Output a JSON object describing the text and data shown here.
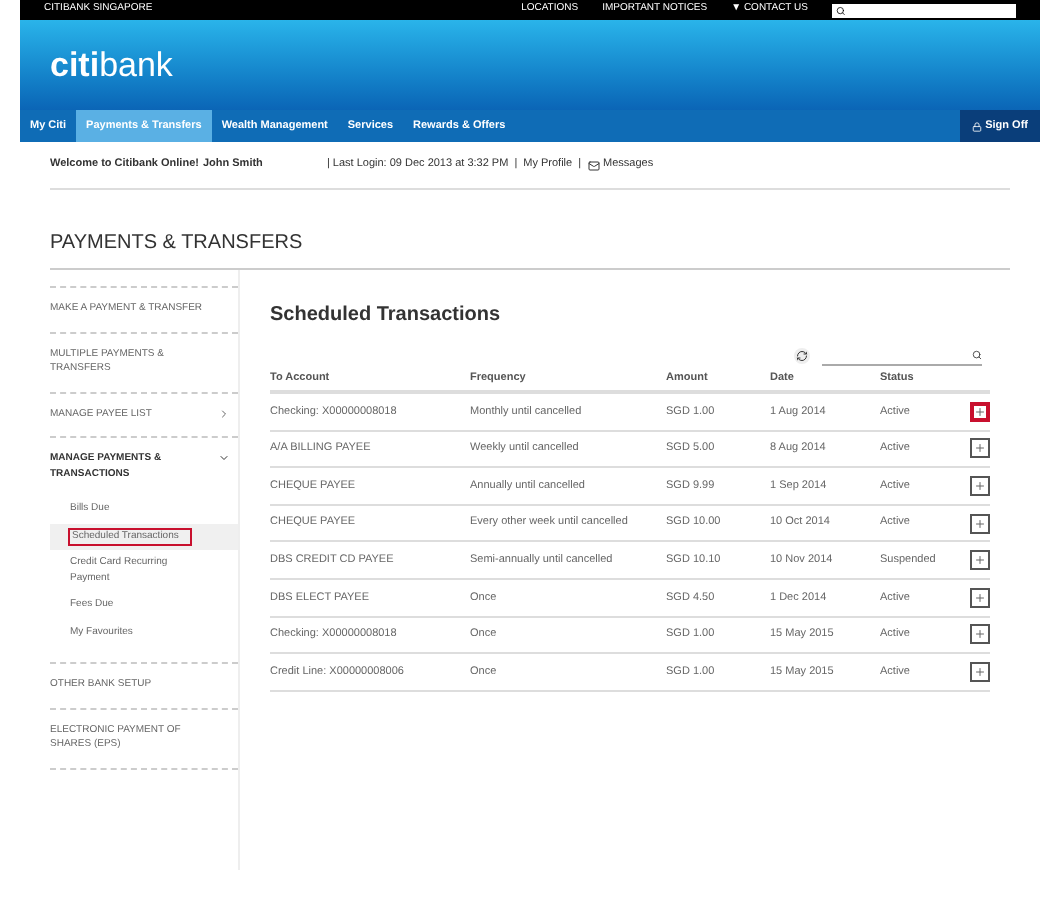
{
  "top_bar": {
    "site": "CITIBANK SINGAPORE",
    "links": [
      "LOCATIONS",
      "IMPORTANT NOTICES",
      "▼ CONTACT US"
    ]
  },
  "logo": {
    "text_a": "citi",
    "text_b": "bank"
  },
  "nav": {
    "tabs": [
      {
        "label": "My Citi",
        "selected": false
      },
      {
        "label": "Payments & Transfers",
        "selected": true
      },
      {
        "label": "Wealth Management",
        "selected": false
      },
      {
        "label": "Services",
        "selected": false
      },
      {
        "label": "Rewards & Offers",
        "selected": false
      }
    ],
    "sign_off": "Sign Off"
  },
  "welcome": {
    "greeting": "Welcome to Citibank Online!",
    "name": "John Smith",
    "last_login": "| Last Login: 09 Dec 2013 at 3:32 PM",
    "separators": [
      "|",
      "|"
    ],
    "profile": "My Profile",
    "messages": "Messages"
  },
  "page_title": "PAYMENTS & TRANSFERS",
  "sidebar": {
    "items": [
      {
        "label": "MAKE A PAYMENT & TRANSFER"
      },
      {
        "label": "MULTIPLE PAYMENTS & TRANSFERS"
      },
      {
        "label": "MANAGE PAYEE LIST",
        "expanded": false
      },
      {
        "label": "MANAGE PAYMENTS & TRANSACTIONS",
        "expanded": true,
        "children": [
          {
            "label": "Bills Due",
            "selected": false
          },
          {
            "label": "Scheduled Transactions",
            "selected": true
          },
          {
            "label": "Credit Card Recurring Payment",
            "selected": false
          },
          {
            "label": "Fees Due",
            "selected": false
          },
          {
            "label": "My Favourites",
            "selected": false
          }
        ]
      },
      {
        "label": "OTHER BANK SETUP"
      },
      {
        "label": "ELECTRONIC PAYMENT OF SHARES (EPS)"
      }
    ]
  },
  "main": {
    "title": "Scheduled Transactions",
    "table": {
      "columns": [
        "To Account",
        "Frequency",
        "Amount",
        "Date",
        "Status"
      ],
      "rows": [
        {
          "cells": [
            "Checking: X00000008018",
            "Monthly until cancelled",
            "SGD 1.00",
            "1 Aug 2014",
            "Active"
          ],
          "highlighted": true
        },
        {
          "cells": [
            "A/A BILLING PAYEE",
            "Weekly until cancelled",
            "SGD 5.00",
            "8 Aug 2014",
            "Active"
          ],
          "highlighted": false
        },
        {
          "cells": [
            "CHEQUE PAYEE",
            "Annually until cancelled",
            "SGD 9.99",
            "1 Sep 2014",
            "Active"
          ],
          "highlighted": false
        },
        {
          "cells": [
            "CHEQUE PAYEE",
            "Every other week until cancelled",
            "SGD 10.00",
            "10 Oct 2014",
            "Active"
          ],
          "highlighted": false
        },
        {
          "cells": [
            "DBS CREDIT CD PAYEE",
            "Semi-annually until cancelled",
            "SGD 10.10",
            "10 Nov 2014",
            "Suspended"
          ],
          "highlighted": false
        },
        {
          "cells": [
            "DBS ELECT PAYEE",
            "Once",
            "SGD 4.50",
            "1 Dec 2014",
            "Active"
          ],
          "highlighted": false
        },
        {
          "cells": [
            "Checking: X00000008018",
            "Once",
            "SGD 1.00",
            "15 May 2015",
            "Active"
          ],
          "highlighted": false
        },
        {
          "cells": [
            "Credit Line: X00000008006",
            "Once",
            "SGD 1.00",
            "15 May 2015",
            "Active"
          ],
          "highlighted": false
        }
      ]
    }
  }
}
